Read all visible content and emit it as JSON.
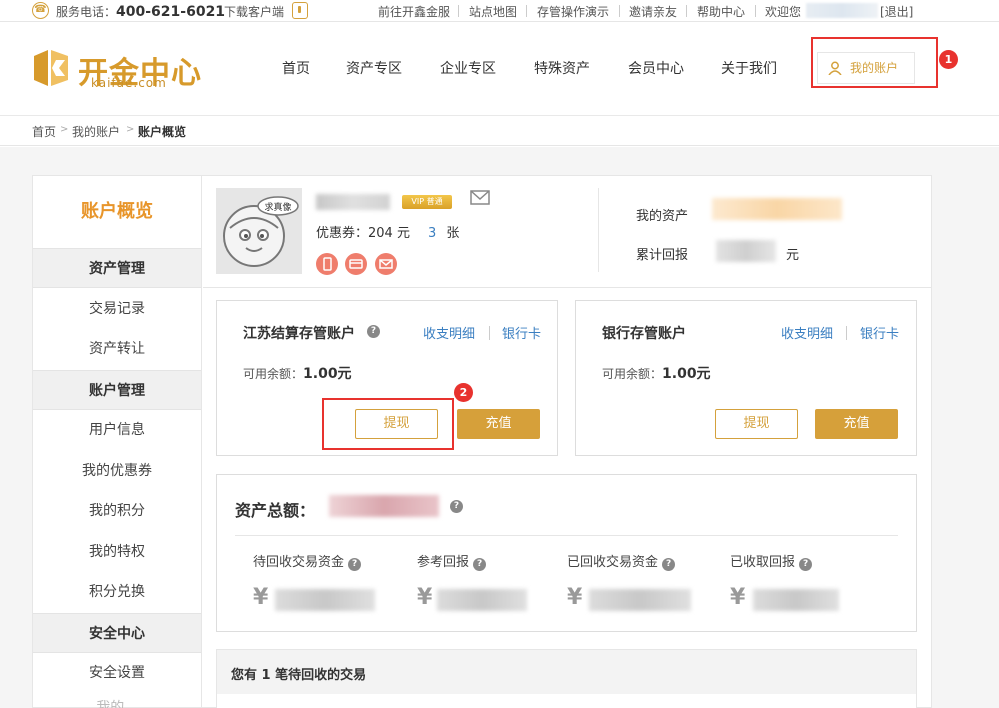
{
  "topbar": {
    "phone_label": "服务电话：",
    "phone_number": "400-621-6021",
    "download": "下载客户端",
    "links": [
      "前往开鑫金服",
      "站点地图",
      "存管操作演示",
      "邀请亲友",
      "帮助中心"
    ],
    "welcome": "欢迎您",
    "logout": "[退出]"
  },
  "header": {
    "logo_text": "开金中心",
    "logo_sub": "kaifae.com",
    "nav": [
      "首页",
      "资产专区",
      "企业专区",
      "特殊资产",
      "会员中心",
      "关于我们"
    ],
    "account_button": "我的账户",
    "badge1": "1"
  },
  "breadcrumb": [
    "首页",
    "我的账户",
    "账户概览"
  ],
  "sidebar": {
    "title": "账户概览",
    "groups": [
      {
        "label": "资产管理",
        "items": [
          "交易记录",
          "资产转让"
        ]
      },
      {
        "label": "账户管理",
        "items": [
          "用户信息",
          "我的优惠券",
          "我的积分",
          "我的特权",
          "积分兑换"
        ]
      },
      {
        "label": "安全中心",
        "items": [
          "安全设置",
          "我的..."
        ]
      }
    ]
  },
  "profile": {
    "avatar_text": "求真像",
    "vip_label": "VIP 普通",
    "coupon_label": "优惠券：204 元",
    "coupon_count": "3",
    "coupon_unit": "张",
    "assets_label": "我的资产",
    "return_label": "累计回报",
    "return_unit": "元"
  },
  "accounts": [
    {
      "title": "江苏结算存管账户",
      "link1": "收支明细",
      "link2": "银行卡",
      "balance_label": "可用余额：",
      "balance": "1.00元",
      "withdraw": "提现",
      "recharge": "充值"
    },
    {
      "title": "银行存管账户",
      "link1": "收支明细",
      "link2": "银行卡",
      "balance_label": "可用余额：",
      "balance": "1.00元",
      "withdraw": "提现",
      "recharge": "充值"
    }
  ],
  "badge2": "2",
  "summary": {
    "title": "资产总额：",
    "metrics": [
      "待回收交易资金",
      "参考回报",
      "已回收交易资金",
      "已收取回报"
    ],
    "yen": "¥"
  },
  "pending": {
    "prefix": "您有",
    "count": "1",
    "suffix": "笔待回收的交易"
  },
  "colors": {
    "accent": "#d6a03a",
    "link": "#3b7fc1",
    "highlight": "#e8322e"
  }
}
